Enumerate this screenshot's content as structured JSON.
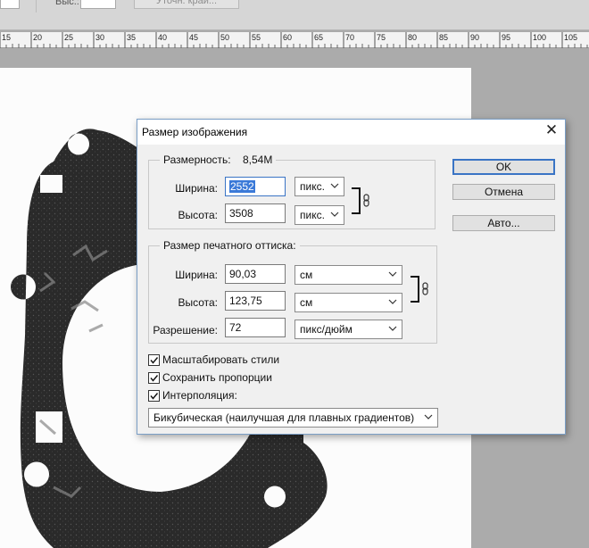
{
  "toolbar": {
    "height_label": "Выс.:",
    "refine_edge_label": "Уточн. край..."
  },
  "ruler": {
    "ticks": [
      "15",
      "20",
      "25",
      "30",
      "35",
      "40",
      "45",
      "50",
      "55",
      "60",
      "65",
      "70",
      "75",
      "80",
      "85",
      "90",
      "95",
      "100",
      "105"
    ]
  },
  "dialog": {
    "title": "Размер изображения",
    "close_glyph": "✕",
    "pixel_dimensions": {
      "legend": "Размерность:",
      "value": "8,54M",
      "width_label": "Ширина:",
      "width_value": "2552",
      "width_unit": "пикс.",
      "height_label": "Высота:",
      "height_value": "3508",
      "height_unit": "пикс."
    },
    "document_size": {
      "legend": "Размер печатного оттиска:",
      "width_label": "Ширина:",
      "width_value": "90,03",
      "width_unit": "см",
      "height_label": "Высота:",
      "height_value": "123,75",
      "height_unit": "см",
      "resolution_label": "Разрешение:",
      "resolution_value": "72",
      "resolution_unit": "пикс/дюйм"
    },
    "checkboxes": [
      {
        "label": "Масштабировать стили",
        "checked": true
      },
      {
        "label": "Сохранить пропорции",
        "checked": true
      },
      {
        "label": "Интерполяция:",
        "checked": true
      }
    ],
    "interpolation_method": "Бикубическая (наилучшая для плавных градиентов)",
    "buttons": {
      "ok": "OK",
      "cancel": "Отмена",
      "auto": "Авто..."
    }
  }
}
